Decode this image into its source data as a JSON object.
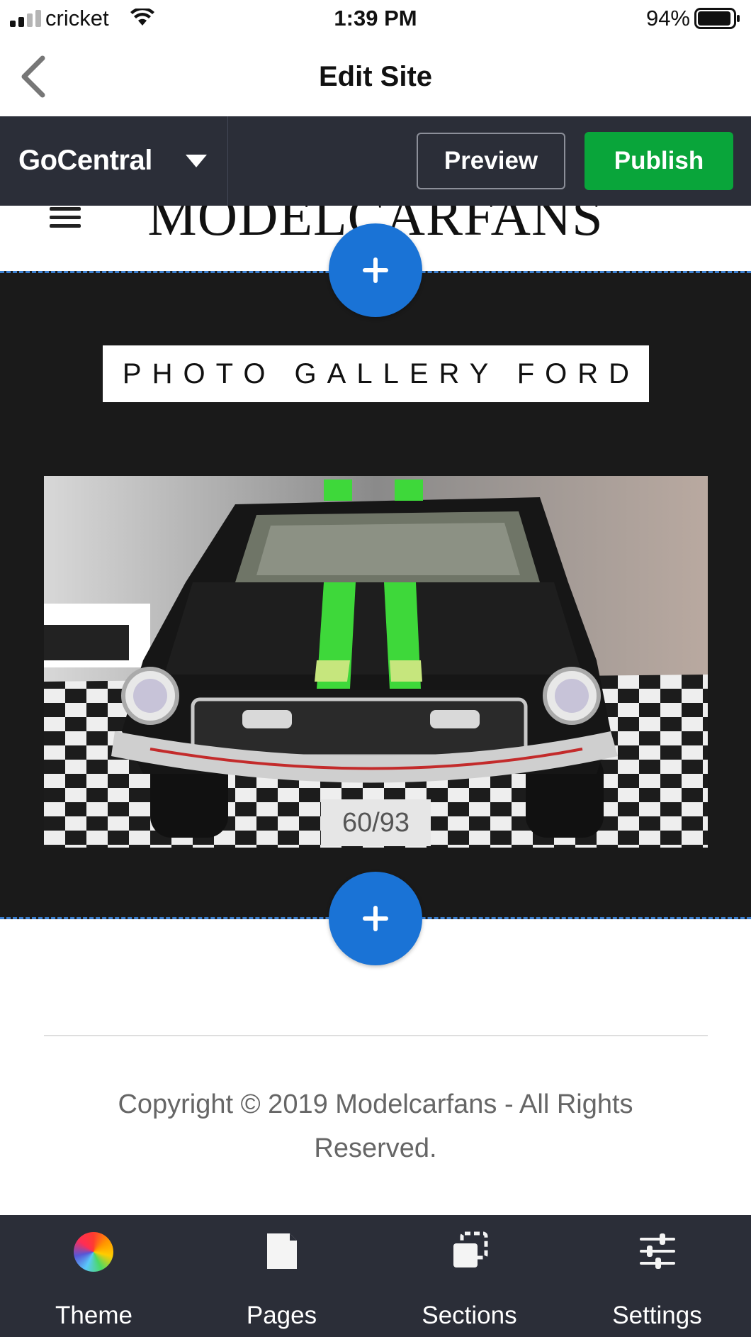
{
  "status_bar": {
    "carrier": "cricket",
    "time": "1:39 PM",
    "battery_percent": "94%",
    "battery_level": 0.94
  },
  "nav": {
    "title": "Edit Site",
    "back_icon": "chevron-left-icon"
  },
  "toolbar": {
    "brand": "GoCentral",
    "preview_label": "Preview",
    "publish_label": "Publish",
    "publish_color": "#09a53a"
  },
  "site": {
    "logo_text": "MODELCARFANS",
    "menu_icon": "hamburger-icon"
  },
  "gallery": {
    "title": "PHOTO GALLERY FORD",
    "counter": "60/93",
    "add_icon": "plus-icon",
    "accent": "#1a73d6"
  },
  "footer": {
    "copyright": "Copyright © 2019 Modelcarfans  - All Rights Reserved."
  },
  "tabbar": {
    "items": [
      {
        "label": "Theme",
        "icon": "color-wheel-icon"
      },
      {
        "label": "Pages",
        "icon": "page-icon"
      },
      {
        "label": "Sections",
        "icon": "sections-icon"
      },
      {
        "label": "Settings",
        "icon": "sliders-icon"
      }
    ]
  }
}
